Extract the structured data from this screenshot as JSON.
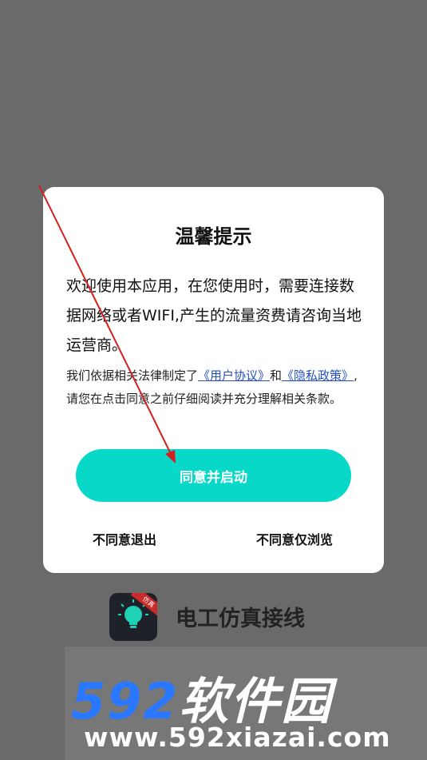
{
  "dialog": {
    "title": "温馨提示",
    "body": "欢迎使用本应用，在您使用时，需要连接数据网络或者WIFI,产生的流量资费请咨询当地运营商。",
    "policy_prefix": "我们依据相关法律制定了",
    "user_agreement_link": "《用户协议》",
    "and_text": "和",
    "privacy_policy_link": "《隐私政策》",
    "policy_suffix": ",请您在点击同意之前仔细阅读并充分理解相关条款。",
    "agree_button": "同意并启动",
    "decline_exit": "不同意退出",
    "decline_browse": "不同意仅浏览"
  },
  "app": {
    "name": "电工仿真接线",
    "icon": "lightbulb-icon",
    "badge": "仿真"
  },
  "watermark": {
    "brand_num": "592",
    "brand_zh": "软件园",
    "url": "www.592xiazai.com"
  },
  "colors": {
    "accent": "#07d8c7",
    "link": "#2550c0",
    "overlay": "#6a6a6a",
    "annotation_arrow": "#d42020"
  }
}
